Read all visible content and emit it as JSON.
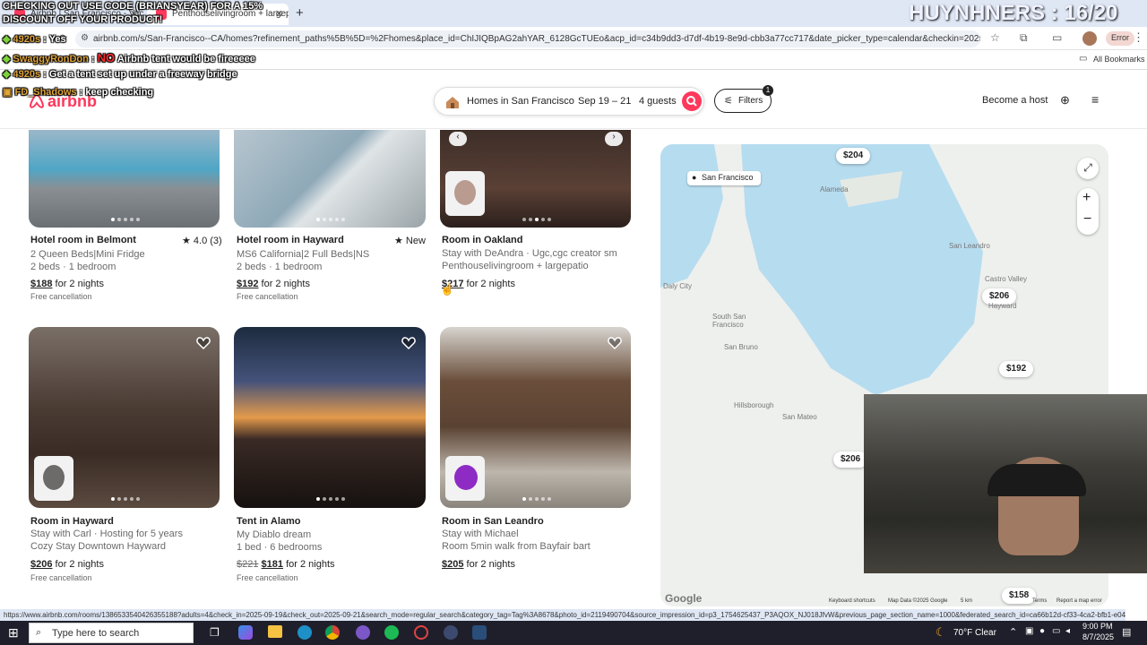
{
  "stream": {
    "promo_line1": "CHECKING OUT USE CODE (BRIANSYEAR) FOR A 15%",
    "promo_line2": "DISCOUNT OFF YOUR PRODUCT!",
    "counter": "HUYNHNERS : 16/20",
    "chat": [
      {
        "user": "4920s",
        "sep": " : ",
        "text": "Yes"
      },
      {
        "user": "SwaggyRonDon",
        "sep": " : ",
        "tag": "NO",
        "text": "Airbnb tent would be fireeeee"
      },
      {
        "user": "4920s",
        "sep": " : ",
        "text": "Get a tent set up under a freeway bridge"
      },
      {
        "user": "FD_Shadows",
        "sep": " : ",
        "text": "keep checking"
      }
    ]
  },
  "browser": {
    "tabs": [
      {
        "label": "Airbnb | San Francisco - Vacat"
      },
      {
        "label": "Penthouselivingroom + largepa"
      }
    ],
    "new_tab": "+",
    "url": "airbnb.com/s/San-Francisco--CA/homes?refinement_paths%5B%5D=%2Fhomes&place_id=ChIJIQBpAG2ahYAR_6128GcTUEo&acp_id=c34b9dd3-d7df-4b19-8e9d-cbb3a77cc717&date_picker_type=calendar&checkin=2025-09-19&checkout...",
    "profile_label": "Error",
    "all_bookmarks": "All Bookmarks",
    "status_url": "https://www.airbnb.com/rooms/1386533540426355188?adults=4&check_in=2025-09-19&check_out=2025-09-21&search_mode=regular_search&category_tag=Tag%3A8678&photo_id=2119490704&source_impression_id=p3_1754625437_P3AQOX_NJ018JfvW&previous_page_section_name=1000&federated_search_id=ca66b12d-cf33-4ca2-bfb1-e0450..."
  },
  "header": {
    "logo": "airbnb",
    "search_location": "Homes in San Francisco",
    "search_dates": "Sep 19 – 21",
    "search_guests": "4 guests",
    "filters_label": "Filters",
    "filters_count": "1",
    "become_host": "Become a host"
  },
  "listings": [
    {
      "title": "Hotel room in Belmont",
      "rating": "★ 4.0 (3)",
      "line1": "2 Queen Beds|Mini Fridge",
      "line2": "2 beds · 1 bedroom",
      "price": "$188",
      "price_suffix": " for 2 nights",
      "free_cancel": "Free cancellation"
    },
    {
      "title": "Hotel room in Hayward",
      "rating": "★ New",
      "line1": "MS6 California|2 Full Beds|NS",
      "line2": "2 beds · 1 bedroom",
      "price": "$192",
      "price_suffix": " for 2 nights",
      "free_cancel": "Free cancellation"
    },
    {
      "title": "Room in Oakland",
      "rating": "",
      "line1": "Stay with DeAndra · Ugc,cgc creator sm",
      "line2": "Penthouselivingroom + largepatio",
      "price": "$217",
      "price_suffix": " for 2 nights",
      "free_cancel": ""
    },
    {
      "title": "Room in Hayward",
      "rating": "",
      "line1": "Stay with Carl · Hosting for 5 years",
      "line2": "Cozy Stay Downtown Hayward",
      "price": "$206",
      "price_suffix": " for 2 nights",
      "free_cancel": "Free cancellation"
    },
    {
      "title": "Tent in Alamo",
      "rating": "",
      "line1": "My Diablo dream",
      "line2": "1 bed · 6 bedrooms",
      "old_price": "$221",
      "price": "$181",
      "price_suffix": " for 2 nights",
      "free_cancel": "Free cancellation"
    },
    {
      "title": "Room in San Leandro",
      "rating": "",
      "line1": "Stay with Michael",
      "line2": "Room 5min walk from Bayfair bart",
      "price": "$205",
      "price_suffix": " for 2 nights",
      "free_cancel": ""
    }
  ],
  "map": {
    "location_chip": "San Francisco",
    "pins": [
      "$204",
      "$206",
      "$192",
      "$206",
      "$158"
    ],
    "places": [
      "Alameda",
      "San Leandro",
      "Castro Valley",
      "Hayward",
      "Daly City",
      "South San Francisco",
      "San Bruno",
      "Hillsborough",
      "San Mateo"
    ],
    "google": "Google",
    "footer": [
      "Keyboard shortcuts",
      "Map Data ©2025 Google",
      "5 km",
      "Terms",
      "Report a map error"
    ]
  },
  "taskbar": {
    "search_placeholder": "Type here to search",
    "weather": "70°F  Clear",
    "time": "9:00 PM",
    "date": "8/7/2025"
  }
}
